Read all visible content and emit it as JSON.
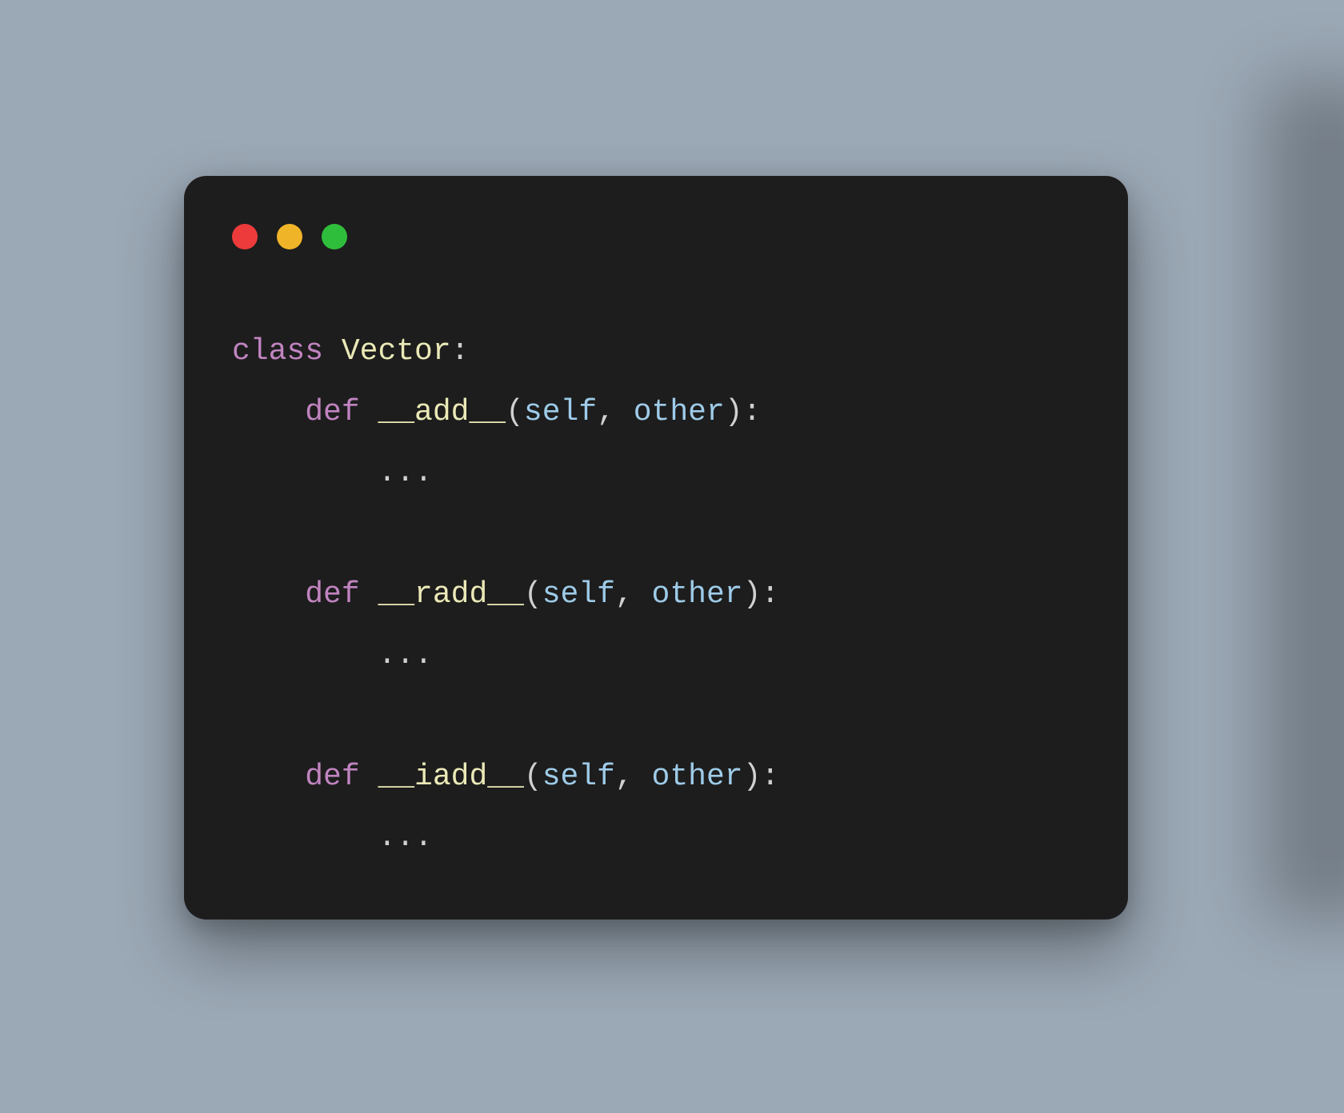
{
  "code": {
    "class_keyword": "class",
    "class_name": "Vector",
    "colon": ":",
    "def_keyword": "def",
    "open_paren": "(",
    "close_paren": ")",
    "comma_space": ", ",
    "param_self": "self",
    "param_other": "other",
    "ellipsis": "...",
    "methods": {
      "m1": "__add__",
      "m2": "__radd__",
      "m3": "__iadd__"
    },
    "indent1": "    ",
    "indent2": "        "
  },
  "colors": {
    "background": "#9ba8b5",
    "window": "#1d1d1d",
    "keyword": "#c084c0",
    "identifier": "#eae9b7",
    "param": "#9ecbe8",
    "default": "#d0d0d0",
    "red": "#ed3b3b",
    "yellow": "#f0b429",
    "green": "#2fbe3c"
  }
}
